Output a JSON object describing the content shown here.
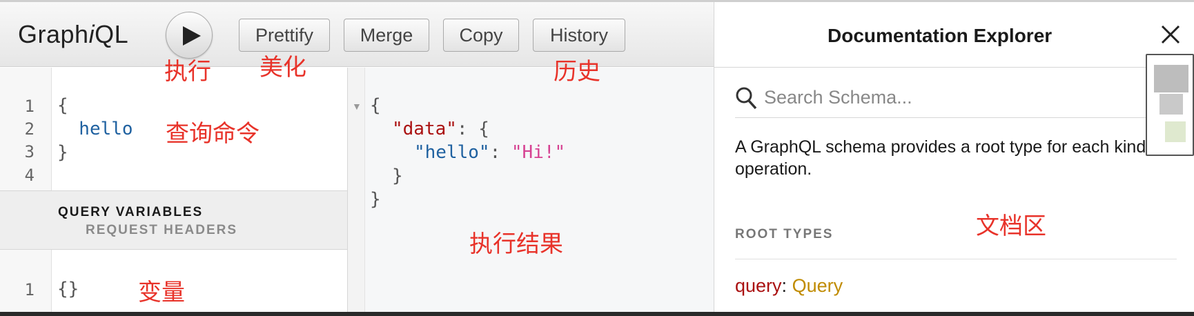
{
  "app": {
    "logo_prefix": "Graph",
    "logo_italic": "i",
    "logo_suffix": "QL"
  },
  "toolbar": {
    "execute_label": "Execute",
    "buttons": [
      "Prettify",
      "Merge",
      "Copy",
      "History"
    ]
  },
  "query_editor": {
    "line_numbers": [
      "1",
      "2",
      "3",
      "4"
    ],
    "lines": [
      "{",
      "  hello",
      "}"
    ]
  },
  "variables": {
    "tab_query_variables": "QUERY VARIABLES",
    "tab_request_headers": "REQUEST HEADERS",
    "line_numbers": [
      "1"
    ],
    "content": "{}"
  },
  "result": {
    "open_brace": "{",
    "data_key": "\"data\"",
    "data_open": ": {",
    "hello_key": "\"hello\"",
    "colon": ": ",
    "hello_value": "\"Hi!\"",
    "inner_close": "}",
    "outer_close": "}"
  },
  "docs": {
    "title": "Documentation Explorer",
    "search_placeholder": "Search Schema...",
    "description": "A GraphQL schema provides a root type for each kind of operation.",
    "root_types_label": "ROOT TYPES",
    "root_field": "query",
    "root_sep": ": ",
    "root_type": "Query"
  },
  "annotations": {
    "execute": "执行",
    "prettify": "美化",
    "history": "历史",
    "query": "查询命令",
    "variables": "变量",
    "result": "执行结果",
    "docs": "文档区"
  },
  "colors": {
    "annotation": "#e8332a",
    "field": "#1f61a0",
    "string": "#d64292",
    "type": "#c08b00"
  }
}
